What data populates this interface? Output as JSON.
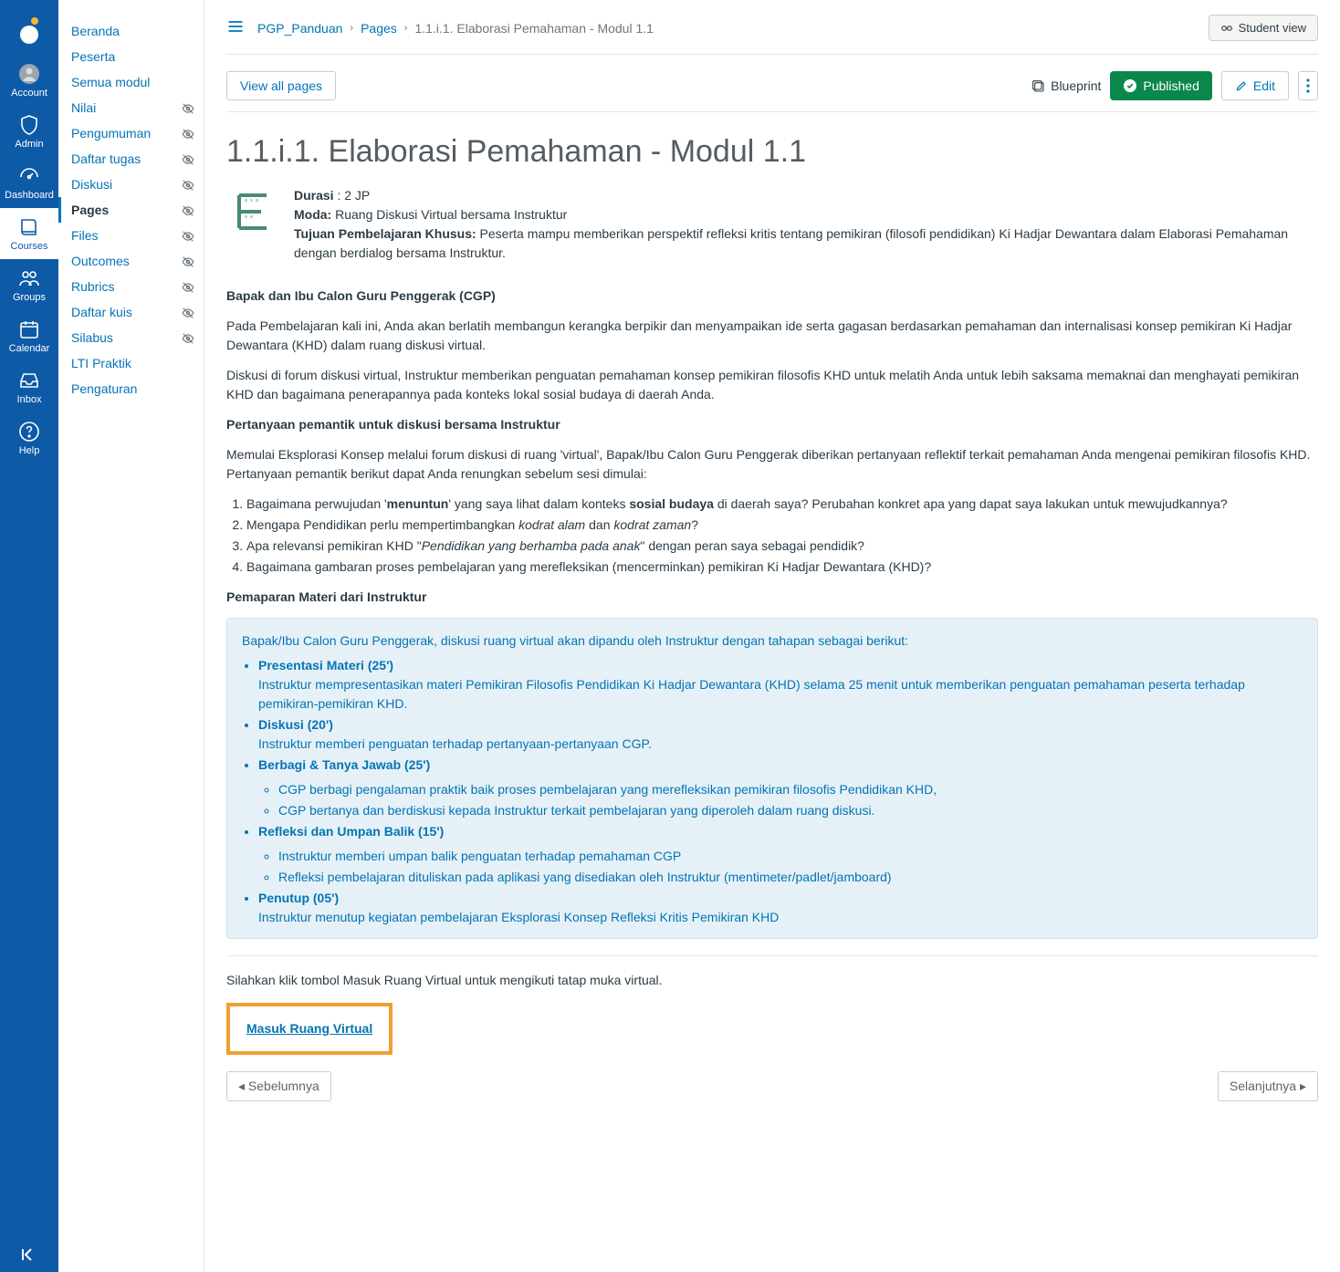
{
  "globalNav": {
    "account": "Account",
    "admin": "Admin",
    "dashboard": "Dashboard",
    "courses": "Courses",
    "groups": "Groups",
    "calendar": "Calendar",
    "inbox": "Inbox",
    "help": "Help"
  },
  "courseNav": {
    "items": [
      {
        "label": "Beranda",
        "hidden": false
      },
      {
        "label": "Peserta",
        "hidden": false
      },
      {
        "label": "Semua modul",
        "hidden": false
      },
      {
        "label": "Nilai",
        "hidden": true
      },
      {
        "label": "Pengumuman",
        "hidden": true
      },
      {
        "label": "Daftar tugas",
        "hidden": true
      },
      {
        "label": "Diskusi",
        "hidden": true
      },
      {
        "label": "Pages",
        "hidden": true,
        "active": true
      },
      {
        "label": "Files",
        "hidden": true
      },
      {
        "label": "Outcomes",
        "hidden": true
      },
      {
        "label": "Rubrics",
        "hidden": true
      },
      {
        "label": "Daftar kuis",
        "hidden": true
      },
      {
        "label": "Silabus",
        "hidden": true
      },
      {
        "label": "LTI Praktik",
        "hidden": false
      },
      {
        "label": "Pengaturan",
        "hidden": false
      }
    ]
  },
  "breadcrumb": {
    "course": "PGP_Panduan",
    "pages": "Pages",
    "current": "1.1.i.1. Elaborasi Pemahaman - Modul 1.1"
  },
  "buttons": {
    "studentView": "Student view",
    "viewAll": "View all pages",
    "blueprint": "Blueprint",
    "published": "Published",
    "edit": "Edit",
    "prev": "Sebelumnya",
    "next": "Selanjutnya"
  },
  "page": {
    "title": "1.1.i.1. Elaborasi Pemahaman - Modul 1.1",
    "durasi_label": "Durasi",
    "durasi_val": " : 2 JP",
    "moda_label": "Moda:",
    "moda_val": " Ruang Diskusi Virtual bersama Instruktur",
    "tujuan_label": "Tujuan Pembelajaran Khusus:",
    "tujuan_val": " Peserta mampu memberikan perspektif refleksi kritis tentang pemikiran (filosofi pendidikan) Ki Hadjar Dewantara dalam Elaborasi Pemahaman dengan berdialog bersama Instruktur.",
    "cgp_heading": "Bapak dan Ibu Calon Guru Penggerak (CGP)",
    "p1": "Pada Pembelajaran kali ini, Anda akan berlatih membangun kerangka berpikir dan menyampaikan ide serta gagasan berdasarkan pemahaman dan internalisasi konsep pemikiran Ki Hadjar Dewantara (KHD) dalam ruang diskusi virtual.",
    "p2": "Diskusi di forum diskusi virtual, Instruktur memberikan penguatan pemahaman konsep pemikiran filosofis KHD untuk melatih Anda untuk lebih saksama memaknai dan menghayati pemikiran KHD dan bagaimana penerapannya pada konteks lokal sosial budaya di daerah Anda.",
    "pemantik_heading": "Pertanyaan pemantik untuk diskusi bersama Instruktur",
    "pemantik_intro": "Memulai Eksplorasi Konsep melalui forum diskusi di ruang 'virtual', Bapak/Ibu Calon Guru Penggerak diberikan pertanyaan reflektif terkait pemahaman Anda mengenai pemikiran filosofis KHD. Pertanyaan pemantik berikut dapat Anda renungkan sebelum sesi dimulai:",
    "q1_a": "Bagaimana perwujudan '",
    "q1_b": "menuntun",
    "q1_c": "' yang saya lihat dalam konteks ",
    "q1_d": "sosial budaya",
    "q1_e": " di daerah saya? Perubahan konkret apa yang dapat saya lakukan untuk mewujudkannya?",
    "q2_a": "Mengapa Pendidikan perlu mempertimbangkan ",
    "q2_b": "kodrat alam",
    "q2_c": " dan ",
    "q2_d": "kodrat zaman",
    "q2_e": "?",
    "q3_a": "Apa relevansi pemikiran KHD \"",
    "q3_b": "Pendidikan yang berhamba pada anak",
    "q3_c": "\" dengan peran saya sebagai pendidik?",
    "q4": "Bagaimana gambaran proses pembelajaran yang merefleksikan (mencerminkan) pemikiran Ki Hadjar Dewantara (KHD)?",
    "materi_heading": "Pemaparan Materi dari Instruktur",
    "box_intro": "Bapak/Ibu Calon Guru Penggerak, diskusi ruang virtual akan dipandu oleh Instruktur dengan tahapan sebagai berikut:",
    "box_1_t": "Presentasi Materi (25')",
    "box_1_d": "Instruktur mempresentasikan materi Pemikiran Filosofis Pendidikan Ki Hadjar Dewantara (KHD) selama 25 menit untuk memberikan penguatan pemahaman peserta terhadap pemikiran-pemikiran KHD.",
    "box_2_t": "Diskusi (20')",
    "box_2_d": "Instruktur memberi penguatan terhadap pertanyaan-pertanyaan CGP.",
    "box_3_t": "Berbagi & Tanya Jawab (25')",
    "box_3_s1": "CGP berbagi pengalaman praktik baik proses pembelajaran yang merefleksikan pemikiran filosofis Pendidikan KHD,",
    "box_3_s2": "CGP bertanya dan berdiskusi kepada Instruktur terkait pembelajaran yang diperoleh dalam ruang diskusi.",
    "box_4_t": "Refleksi dan Umpan Balik (15')",
    "box_4_s1": "Instruktur memberi umpan balik penguatan terhadap pemahaman CGP",
    "box_4_s2": "Refleksi pembelajaran dituliskan pada aplikasi yang disediakan oleh Instruktur (mentimeter/padlet/jamboard)",
    "box_5_t": "Penutup (05')",
    "box_5_d": "Instruktur menutup kegiatan pembelajaran Eksplorasi Konsep Refleksi Kritis Pemikiran KHD",
    "instruksi": "Silahkan klik tombol Masuk Ruang Virtual untuk mengikuti tatap muka virtual.",
    "virtual_link": "Masuk Ruang Virtual"
  }
}
